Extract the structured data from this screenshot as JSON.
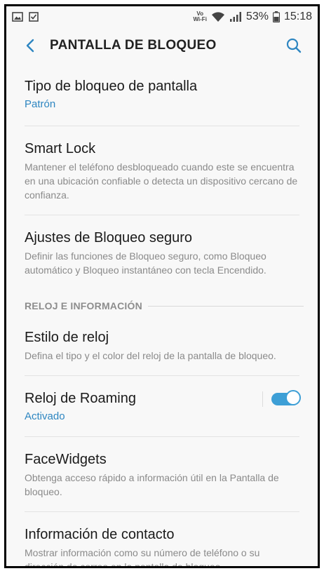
{
  "status_bar": {
    "battery": "53%",
    "time": "15:18",
    "vowifi_line1": "Vo",
    "vowifi_line2": "Wi‑Fi",
    "icons": [
      "image-icon",
      "checkbox-icon",
      "vowifi-icon",
      "wifi-icon",
      "signal-icon",
      "battery-icon"
    ]
  },
  "header": {
    "title": "PANTALLA DE BLOQUEO",
    "back_icon": "chevron-left-icon",
    "search_icon": "search-icon"
  },
  "items": [
    {
      "title": "Tipo de bloqueo de pantalla",
      "subtitle": "Patrón"
    },
    {
      "title": "Smart Lock",
      "subtitle": "Mantener el teléfono desbloqueado cuando este se encuentra en una ubicación confiable o detecta un dispositivo cercano de confianza."
    },
    {
      "title": "Ajustes de Bloqueo seguro",
      "subtitle": "Definir las funciones de Bloqueo seguro, como Bloqueo automático y Bloqueo instantáneo con tecla Encendido."
    }
  ],
  "section": {
    "label": "RELOJ E INFORMACIÓN"
  },
  "items2": [
    {
      "title": "Estilo de reloj",
      "subtitle": "Defina el tipo y el color del reloj de la pantalla de bloqueo."
    },
    {
      "title": "Reloj de Roaming",
      "subtitle": "Activado",
      "toggle_on": true
    },
    {
      "title": "FaceWidgets",
      "subtitle": "Obtenga acceso rápido a información útil en la Pantalla de bloqueo."
    },
    {
      "title": "Información de contacto",
      "subtitle": "Mostrar información como su número de teléfono o su dirección de correo en la pantalla de bloqueo."
    }
  ],
  "colors": {
    "accent": "#2e86c1",
    "toggle": "#3d9fd6",
    "background": "#f8f8f8"
  }
}
